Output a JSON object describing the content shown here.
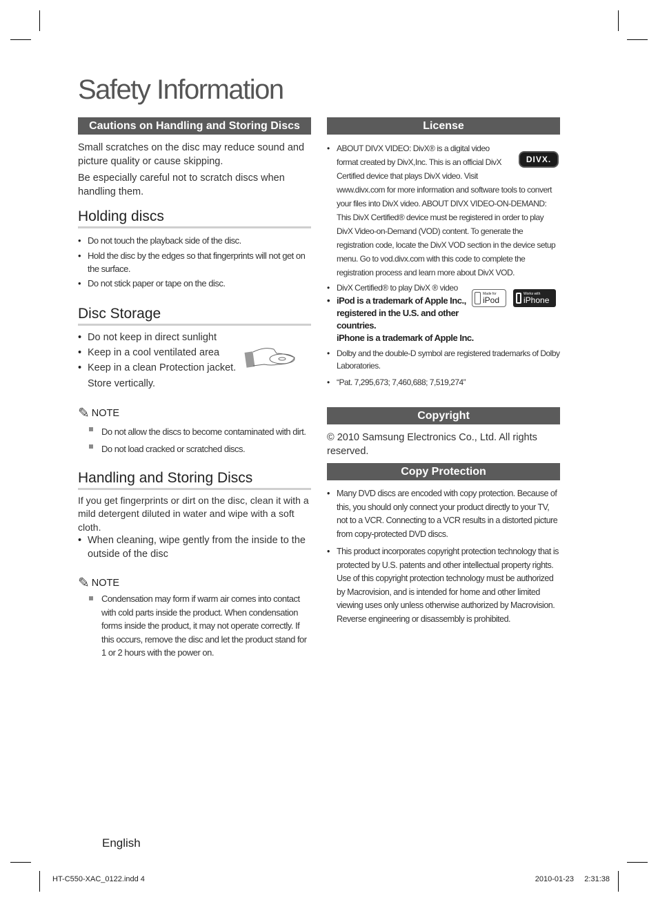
{
  "page": {
    "title": "Safety Information",
    "footer_language": "English",
    "slug_file": "HT-C550-XAC_0122.indd   4",
    "slug_date": "2010-01-23",
    "slug_time": "2:31:38"
  },
  "left": {
    "cautions": {
      "bar": "Cautions on Handling and Storing Discs",
      "para1": "Small scratches on the disc may reduce sound and picture quality or cause skipping.",
      "para2": "Be especially careful not to scratch discs when handling them."
    },
    "holding": {
      "heading": "Holding discs",
      "items": [
        "Do not touch the playback side of the disc.",
        "Hold the disc by the edges so that fingerprints will not get on the surface.",
        "Do not stick paper or tape on the disc."
      ]
    },
    "storage": {
      "heading": "Disc Storage",
      "items": [
        "Do not keep in direct sunlight",
        "Keep in a cool ventilated area",
        "Keep in a clean Protection jacket."
      ],
      "extra": "Store vertically.",
      "illustration": "hand-holding-disc-icon"
    },
    "note1": {
      "label": "NOTE",
      "items": [
        "Do not allow the discs to become contaminated with dirt.",
        "Do not load cracked or scratched discs."
      ]
    },
    "handling": {
      "heading": "Handling and Storing Discs",
      "para": "If you get fingerprints or dirt on the disc, clean it with a mild detergent diluted in water and wipe with a soft cloth.",
      "items": [
        "When cleaning, wipe gently from the inside to the outside of the disc"
      ]
    },
    "note2": {
      "label": "NOTE",
      "items": [
        "Condensation may form if warm air comes into contact with cold parts inside the product. When condensation forms inside the product, it may not operate correctly. If this occurs, remove the disc and let the product stand for 1 or 2 hours with the power on."
      ]
    }
  },
  "right": {
    "license": {
      "bar": "License",
      "divx_text": "ABOUT DIVX VIDEO: DivX® is a digital video format created by DivX,Inc. This is an official DivX Certified device that plays DivX video. Visit www.divx.com for more information and software tools to convert your files into DivX video. ABOUT DIVX VIDEO-ON-DEMAND: This DivX Certified® device must be registered in order to play DivX Video-on-Demand (VOD) content. To generate the registration code, locate the DivX VOD section in the device setup menu. Go to vod.divx.com with this  code to complete the registration process and learn more about DivX VOD.",
      "divx_logo": "DIVX.",
      "divx_certified": "DivX Certified® to play DivX ® video",
      "apple_line1": "iPod is a trademark of Apple Inc., registered in the U.S. and other countries.",
      "apple_line2": "iPhone is a trademark of Apple Inc.",
      "ipod_badge_small": "Made for",
      "ipod_badge_big": "iPod",
      "iphone_badge_small": "Works with",
      "iphone_badge_big": "iPhone",
      "dolby": "Dolby and the double-D symbol are registered trademarks of Dolby Laboratories.",
      "patents": "“Pat. 7,295,673; 7,460,688; 7,519,274”"
    },
    "copyright": {
      "bar": "Copyright",
      "text": "© 2010 Samsung Electronics Co., Ltd. All rights reserved."
    },
    "copy_protection": {
      "bar": "Copy Protection",
      "items": [
        "Many DVD discs are encoded with copy protection. Because of this, you should only connect your product directly to your TV, not to a VCR. Connecting to a VCR results in a distorted picture from copy-protected DVD discs.",
        "This product incorporates copyright protection technology that is protected by U.S. patents and other intellectual property rights. Use of this copyright protection technology must be authorized by Macrovision, and is intended for home and other limited viewing uses only unless otherwise authorized by Macrovision. Reverse engineering or disassembly is prohibited."
      ]
    }
  }
}
